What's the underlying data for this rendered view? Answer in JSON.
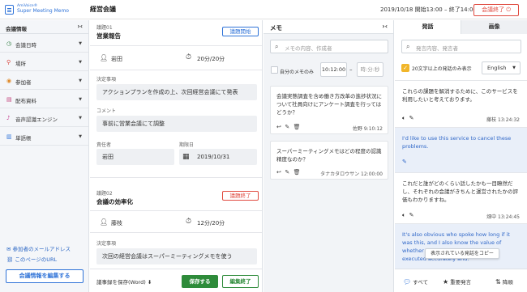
{
  "header": {
    "brand": "AmiVoice®",
    "product": "Super Meeting Memo",
    "meeting_title": "経営会議",
    "time_info": "2019/10/18 開始13:00 – 終了14:00",
    "end_button": "会議終了 ⏻"
  },
  "sidebar": {
    "title": "会議情報",
    "collapse": "›‹",
    "items": [
      {
        "icon": "clock-icon",
        "glyph": "◷",
        "color": "#2a7a3b",
        "label": "会議日時"
      },
      {
        "icon": "pin-icon",
        "glyph": "⚲",
        "color": "#d9433a",
        "label": "場所"
      },
      {
        "icon": "person-icon",
        "glyph": "◉",
        "color": "#e08a2a",
        "label": "参加者"
      },
      {
        "icon": "document-icon",
        "glyph": "▤",
        "color": "#c2417a",
        "label": "配布資料"
      },
      {
        "icon": "mic-icon",
        "glyph": "♪",
        "color": "#c43a8e",
        "label": "音声認識エンジン"
      },
      {
        "icon": "book-icon",
        "glyph": "▥",
        "color": "#2f73d8",
        "label": "単語帳"
      }
    ],
    "links": [
      {
        "icon": "mail-icon",
        "glyph": "✉",
        "label": "参加者のメールアドレス"
      },
      {
        "icon": "link-icon",
        "glyph": "⛓",
        "label": "このページのURL"
      }
    ],
    "edit_button": "会議情報を編集する"
  },
  "agenda": {
    "items": [
      {
        "number": "議題01",
        "title": "営業報告",
        "status": "議題開始",
        "owner": "岩田",
        "time": "20分/20分",
        "decision_label": "決定事項",
        "decision": "アクションプランを作成の上、次回経営会議にて発表",
        "comment_label": "コメント",
        "comment": "事前に営業会議にて調整",
        "responsible_label": "責任者",
        "responsible": "岩田",
        "deadline_label": "期限日",
        "deadline": "2019/10/31"
      },
      {
        "number": "議題02",
        "title": "会議の効率化",
        "status": "議題終了",
        "owner": "藤枝",
        "time": "12分/20分",
        "decision_label": "決定事項",
        "decision": "次回の経営会議はスーパーミーティングメモを使う"
      }
    ],
    "footer": {
      "save_word": "議事録を保存(Word) ⬇",
      "save": "保存する",
      "edit_done": "編集終了"
    }
  },
  "memo": {
    "title": "メモ",
    "collapse": "›‹",
    "search_placeholder": "メモの内容、作成者",
    "own_only": "自分のメモのみ",
    "time_from": "10:12:00",
    "time_to": "時:分:秒",
    "time_sep": "–",
    "cards": [
      {
        "text": "会議実態調査を含め働き方改革の進捗状況について社員向けにアンケート調査を行ってはどうか？",
        "author": "佐野",
        "time": "9:10:12"
      },
      {
        "text": "スーパーミーティングメモはどの程度の認識精度なのか？",
        "author": "タナカタロウサン",
        "time": "12:00:00"
      }
    ]
  },
  "utterances": {
    "tabs": [
      "発話",
      "画像"
    ],
    "search_placeholder": "発言内容、発言者",
    "filter_label": "20文字以上の発話のみ表示",
    "language": "English",
    "items": [
      {
        "lang": "ja",
        "text": "これらの課題を解消するために、このサービスを利用したいと考えております。",
        "speaker": "藤枝",
        "time": "13:24:32"
      },
      {
        "lang": "en",
        "text": "I'd like to use this service to cancel these problems."
      },
      {
        "lang": "ja",
        "text": "これだと誰がどのくらい話したかも一目瞭然だし、それぞれの会議がきちんと運営されたかの評価もわかりますね。",
        "speaker": "畑中",
        "time": "13:24:45"
      },
      {
        "lang": "en",
        "text": "It's also obvious who spoke how long if it was this, and I also know the value of whether each meeting was properly executed accurately and."
      }
    ],
    "tooltip": "表示されている発話をコピー",
    "footer": {
      "all": "すべて",
      "important": "重要発言",
      "order": "降順"
    }
  }
}
